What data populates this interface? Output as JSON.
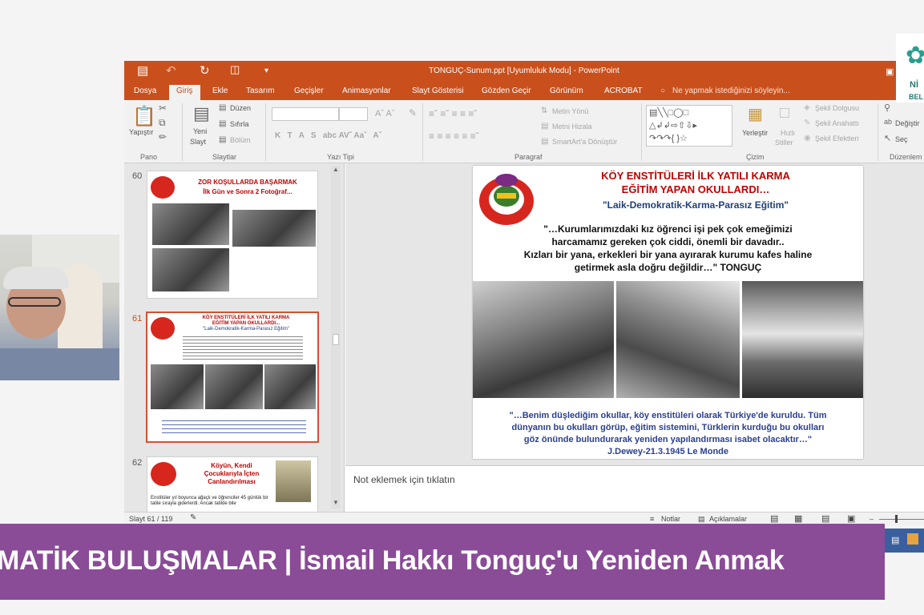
{
  "window": {
    "title": "TONGUÇ-Sunum.ppt [Uyumluluk Modu] - PowerPoint"
  },
  "ribbon": {
    "tabs": [
      "Dosya",
      "Giriş",
      "Ekle",
      "Tasarım",
      "Geçişler",
      "Animasyonlar",
      "Slayt Gösterisi",
      "Gözden Geçir",
      "Görünüm",
      "ACROBAT"
    ],
    "active_tab": "Giriş",
    "tell_me": "Ne yapmak istediğinizi söyleyin...",
    "groups": {
      "pano": "Pano",
      "slaytlar": "Slaytlar",
      "yazi_tipi": "Yazı Tipi",
      "paragraf": "Paragraf",
      "cizim": "Çizim",
      "duzenleme": "Düzenlem"
    },
    "buttons": {
      "yapistir": "Yapıştır",
      "yeni": "Yeni",
      "slayt": "Slayt",
      "duzen": "Düzen",
      "sifirla": "Sıfırla",
      "bolum": "Bölüm",
      "metin_yonu": "Metin Yönü",
      "metni_hizala": "Metni Hizala",
      "smartart": "SmartArt'a Dönüştür",
      "yerlestir": "Yerleştir",
      "hizli": "Hızlı",
      "stiller": "Stiller",
      "sekil_dolgusu": "Şekil Dolgusu",
      "sekil_anahatti": "Şekil Anahattı",
      "sekil_efektleri": "Şekil Efektleri",
      "degistir": "Değiştir",
      "sec": "Seç"
    }
  },
  "thumbnails": [
    {
      "number": "60",
      "title_lines": [
        "ZOR KOŞULLARDA BAŞARMAK",
        "İlk Gün ve Sonra 2 Fotoğraf..."
      ]
    },
    {
      "number": "61",
      "title_lines": [
        "KÖY ENSTİTÜLERİ İLK YATILI KARMA",
        "EĞİTİM YAPAN OKULLARDI..."
      ],
      "subtitle": "\"Laik-Demokratik-Karma-Parasız Eğitim\""
    },
    {
      "number": "62",
      "title_lines": [
        "Köyün, Kendi",
        "Çocuklarıyla İçten",
        "Canlandırılması"
      ],
      "body": "Enstitüler yıl boyunca ağaçlı ve öğrenciler 45 günlük bir tatile sırayla giderlerdi. Ancak tatilde bile"
    }
  ],
  "slide": {
    "title_line1": "KÖY ENSTİTÜLERİ  İLK YATILI KARMA",
    "title_line2": "EĞİTİM YAPAN OKULLARDI…",
    "subtitle": "\"Laik-Demokratik-Karma-Parasız Eğitim\"",
    "quote_lines": [
      "\"…Kurumlarımızdaki kız öğrenci işi pek çok emeğimizi",
      "harcamamız gereken çok ciddi, önemli bir davadır..",
      "Kızları bir yana, erkekleri bir yana ayırarak kurumu kafes haline",
      "getirmek asla doğru değildir…\"  TONGUÇ"
    ],
    "quote2_lines": [
      "\"…Benim düşlediğim okullar, köy enstitüleri olarak Türkiye'de kuruldu. Tüm",
      "dünyanın bu okulları görüp, eğitim sistemini, Türklerin kurduğu bu okulları",
      "göz önünde bulundurarak yeniden yapılandırması isabet olacaktır…\"",
      "J.Dewey-21.3.1945 Le Monde"
    ]
  },
  "notes_placeholder": "Not eklemek için tıklatın",
  "status": {
    "slide_counter": "Slayt 61 / 119",
    "notes": "Notlar",
    "comments": "Açıklamalar"
  },
  "banner": {
    "text": "MATİK BULUŞMALAR | İsmail Hakkı Tonguç'u Yeniden Anmak"
  },
  "brand": {
    "line1": "Nİ",
    "line2": "BEL"
  },
  "colors": {
    "ppt_accent": "#c9501c",
    "banner": "#8a4b97",
    "slide_title": "#c00000",
    "slide_subtitle": "#1f3f7a"
  }
}
